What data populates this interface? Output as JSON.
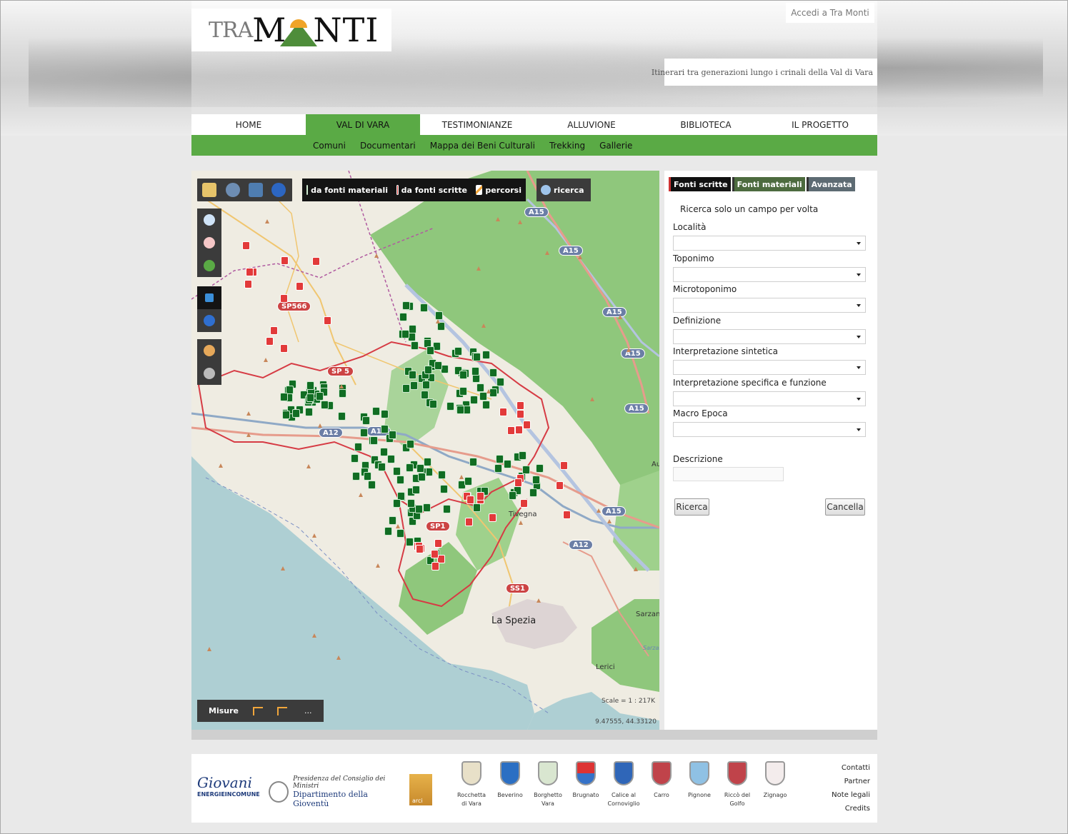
{
  "header": {
    "logo_tra": "TRA",
    "logo_m": "M",
    "logo_nti": "NTI",
    "login": "Accedi a Tra Monti",
    "tagline": "Itinerari tra generazioni lungo i crinali della Val di Vara"
  },
  "nav": {
    "items": [
      {
        "label": "HOME"
      },
      {
        "label": "VAL DI VARA",
        "active": true
      },
      {
        "label": "TESTIMONIANZE"
      },
      {
        "label": "ALLUVIONE"
      },
      {
        "label": "BIBLIOTECA"
      },
      {
        "label": "IL PROGETTO"
      }
    ],
    "sub": [
      "Comuni",
      "Documentari",
      "Mappa dei Beni Culturali",
      "Trekking",
      "Gallerie"
    ]
  },
  "map": {
    "layers": {
      "materiali": "da fonti materiali",
      "scritte": "da fonti scritte",
      "percorsi": "percorsi",
      "ricerca": "ricerca"
    },
    "labels": {
      "la_spezia": "La Spezia",
      "tivegna": "Tivegna",
      "sarzana": "Sarzan",
      "lerici": "Lerici",
      "au": "Au",
      "sarzar": "Sarzar"
    },
    "shields": {
      "a15": "A15",
      "a12": "A12",
      "sp566": "SP566",
      "sp1": "SP1",
      "ss1": "SS1",
      "sp5": "SP 5"
    },
    "measure_label": "Misure",
    "measure_more": "...",
    "scale": "Scale = 1 : 217K",
    "coords": "9.47555, 44.33120",
    "colors": {
      "materiali": "#116d23",
      "scritte": "#e23a3a"
    }
  },
  "panel": {
    "tabs": [
      "Fonti scritte",
      "Fonti materiali",
      "Avanzata"
    ],
    "hint": "Ricerca solo un campo per volta",
    "fields": [
      "Località",
      "Toponimo",
      "Microtoponimo",
      "Definizione",
      "Interpretazione sintetica",
      "Interpretazione specifica e funzione",
      "Macro Epoca"
    ],
    "descrizione": "Descrizione",
    "search_btn": "Ricerca",
    "cancel_btn": "Cancella"
  },
  "footer": {
    "giovani": "Giovani",
    "energie": "ENERGIEINCOMUNE",
    "presidenza": "Presidenza del Consiglio dei Ministri",
    "dipartimento": "Dipartimento della Gioventù",
    "arci": "arci",
    "comuni": [
      [
        "Rocchetta",
        "di Vara"
      ],
      [
        "Beverino",
        ""
      ],
      [
        "Borghetto",
        "Vara"
      ],
      [
        "Brugnato",
        ""
      ],
      [
        "Calice al",
        "Cornoviglio"
      ],
      [
        "Carro",
        ""
      ],
      [
        "Pignone",
        ""
      ],
      [
        "Riccò del",
        "Golfo"
      ],
      [
        "Zignago",
        ""
      ]
    ],
    "links": [
      "Contatti",
      "Partner",
      "Note legali",
      "Credits"
    ]
  }
}
